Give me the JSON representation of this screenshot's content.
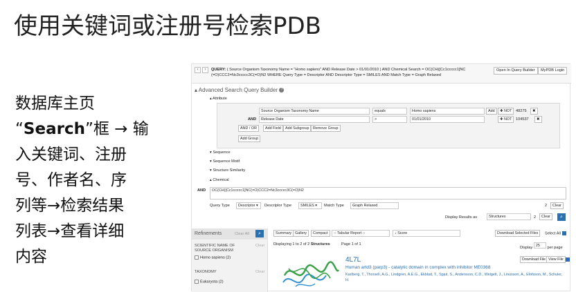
{
  "slide": {
    "title": "使用关键词或注册号检索PDB",
    "body_line1": "数据库主页",
    "body_line2_prefix": "“",
    "body_line2_bold": "Search",
    "body_line2_suffix": "”框 → 输",
    "body_line3": "入关键词、注册",
    "body_line4": "号、作者名、序",
    "body_line5": "列等→检索结果",
    "body_line6": "列表→查看详细",
    "body_line7": "内容"
  },
  "topbar": {
    "back": "‹",
    "forward": "›",
    "query_label": "QUERY:",
    "query_line1": " ( Source Organism Taxonomy Name = \"Homo sapiens\" AND Release Date > 01/01/2010 ) AND Chemical Search = OC(CH)[Cc1ccccc1]NC",
    "query_line2": "(=O)CCC2=Nc3ccccc3C(=O)N2 WHERE Query Type = Descriptor AND Descriptor Type = SMILES AND Match Type = Graph Relaxed",
    "open_builder": "Open In Query Builder",
    "mypdb": "MyPDB Login"
  },
  "builder": {
    "title": "▴ Advanced Search Query Builder",
    "attribute": "▴ Attribute",
    "row1": {
      "field": "Source Organism Taxonomy Name",
      "op": "equals",
      "value": "Homo sapiens",
      "add": "Add",
      "not": "✚ NOT",
      "count": "48275",
      "remove": "✖"
    },
    "row2": {
      "bool": "AND",
      "field": "Release Date",
      "op": ">",
      "value": "01/01/2010",
      "not": "✚ NOT",
      "count": "104537",
      "remove": "✖"
    },
    "andor": "AND / OR",
    "add_field": "Add Field",
    "add_subgroup": "Add Subgroup",
    "remove_group": "Remove Group",
    "add_group": "Add Group",
    "sequence": "▾ Sequence",
    "sequence_motif": "▾ Sequence Motif",
    "structure_similarity": "▾ Structure Similarity",
    "chemical": "▴ Chemical",
    "chem_and": "AND",
    "chem_value": "OC(CH)[Cc1ccccc1]NC(=O)CCC2=Nc3ccccc3C(=O)N2",
    "query_type_label": "Query Type",
    "query_type": "Descriptor ▾",
    "descriptor_type_label": "Descriptor Type",
    "descriptor_type": "SMILES ▾",
    "match_type_label": "Match Type",
    "match_type": "Graph Relaxed",
    "count": "2",
    "clear": "Clear",
    "display_as_label": "Display Results as",
    "display_as": "Structures",
    "count2": "2",
    "clear2": "Clear",
    "search_icon": "⌕"
  },
  "refinements": {
    "title": "Refinements",
    "clear_all": "Clear All",
    "group1_title": "SCIENTIFIC NAME OF SOURCE ORGANISM",
    "group1_clear": "Clear",
    "group1_item": "Homo sapiens (2)",
    "group2_title": "TAXONOMY",
    "group2_clear": "Clear",
    "group2_item": "Eukaryota (2)"
  },
  "results": {
    "tabs": [
      "Summary",
      "Gallery",
      "Compact"
    ],
    "report": "-- Tabular Report --",
    "sort": "↓ Score",
    "download_selected": "Download Selected Files",
    "select_all": "Select All",
    "displaying": "Displaying 1 to 2 of 2",
    "displaying_bold": "Structures",
    "page": "Page 1 of 1",
    "display_label": "Display",
    "per_page": "25",
    "per_page_suffix": "per page",
    "entry_id": "4L7L",
    "download_file": "Download File",
    "view_file": "View File",
    "entry_title": "Human artd3 (parp3) - catalytic domain in complex with inhibitor ME0368",
    "entry_authors": "Karlberg, T., Thorsell, A.G., Lindgren, A.E.G., Ekblad, T., Spjut, S., Andersson, C.D., Weigelt, J., Linusson, A., Elofsson, M., Schuler, H."
  }
}
